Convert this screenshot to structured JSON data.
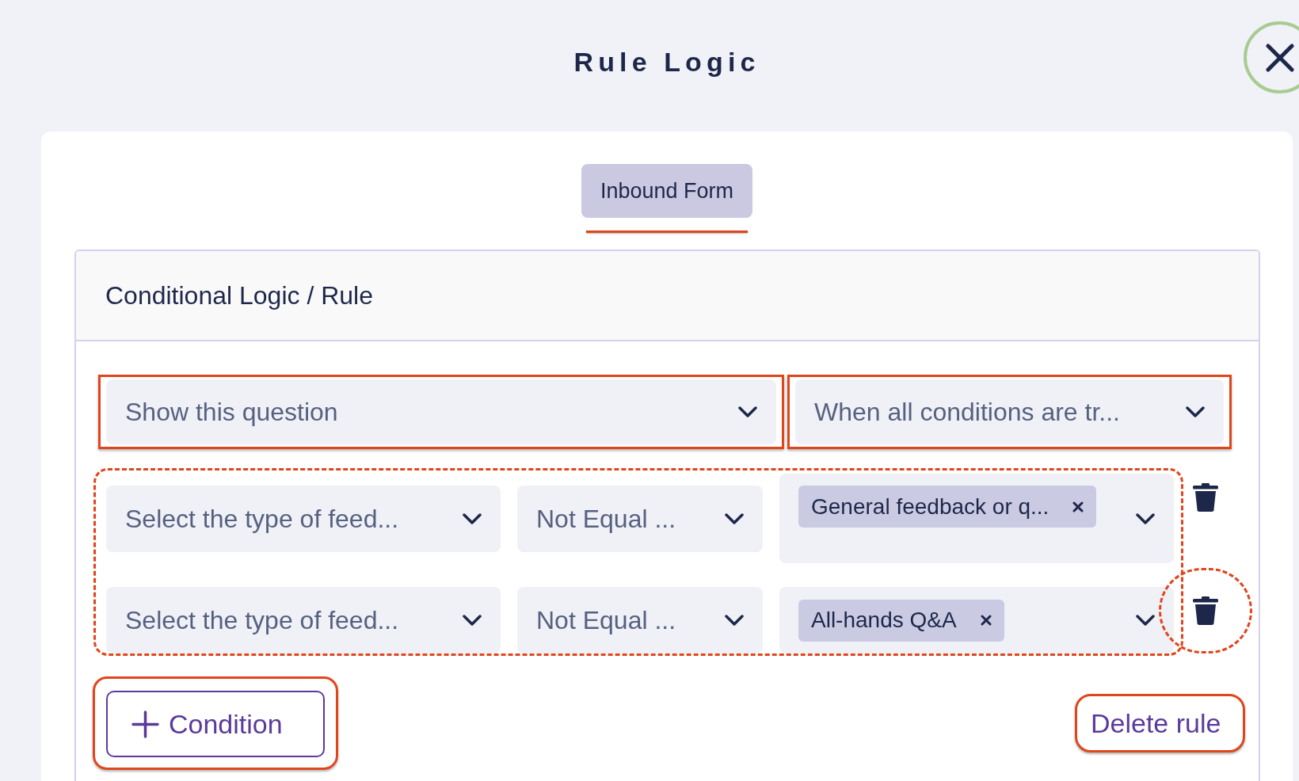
{
  "dialog": {
    "title": "Rule Logic"
  },
  "tabs": [
    {
      "label": "Inbound Form",
      "selected": true
    }
  ],
  "rule_panel": {
    "title": "Conditional Logic / Rule",
    "action_select": {
      "value": "Show this question",
      "highlighted": true
    },
    "match_select": {
      "value": "When all conditions are tr...",
      "highlighted": true
    },
    "conditions_highlighted": true,
    "conditions": [
      {
        "field": "Select the type of feed...",
        "operator": "Not Equal ...",
        "values": [
          "General feedback or q..."
        ],
        "delete_highlighted": false
      },
      {
        "field": "Select the type of feed...",
        "operator": "Not Equal ...",
        "values": [
          "All-hands Q&A"
        ],
        "delete_highlighted": true
      }
    ],
    "add_condition_button": {
      "label": "Condition",
      "highlighted": true
    },
    "delete_rule_button": {
      "label": "Delete rule",
      "highlighted": true
    }
  }
}
